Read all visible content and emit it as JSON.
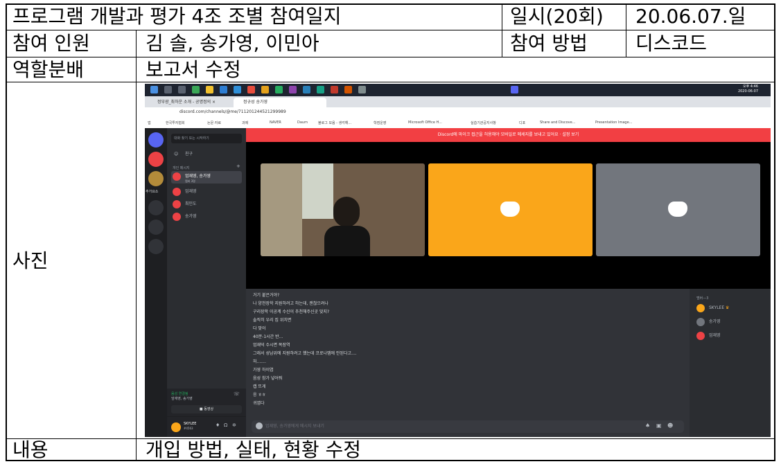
{
  "header": {
    "title": "프로그램 개발과 평가 4조 조별 참여일지",
    "date_label": "일시(20회)",
    "date_value": "20.06.07.일"
  },
  "participants": {
    "label": "참여 인원",
    "value": "김 솔, 송가영, 이민아",
    "method_label": "참여 방법",
    "method_value": "디스코드"
  },
  "role": {
    "label": "역할분배",
    "value": "보고서 수정"
  },
  "photo": {
    "label": "사진"
  },
  "content": {
    "label": "내용",
    "value": "개입 방법, 실태, 현황 수정"
  },
  "screenshot": {
    "clock": "오후 4:46",
    "clock_date": "2020-06-07",
    "tabs": [
      "정부광_최하운 소개 - 공명정의 ×",
      "정규성 송가영"
    ],
    "url": "discord.com/channels/@me/711201244521299989",
    "bookmarks": [
      "앱",
      "한국투자협회",
      "논문·자료",
      "과제",
      "NAVER",
      "Daum",
      "블로그 모음 - 생각해...",
      "학점운영",
      "Microsoft Office H...",
      "실습기관공지사항",
      "디포",
      "Share and Discove...",
      "Presentation Image..."
    ],
    "dm_search": "대화 찾기 또는 시작하기",
    "friends_label": "친구",
    "dm_header": "개인 메시지",
    "dm_items": [
      "엄재영, 송가영",
      "엄재영",
      "최민도",
      "송가영"
    ],
    "dm_sub": "멤버 3명",
    "server_label": "추가요소",
    "voice_status": "음성 연결됨",
    "voice_channel": "엄재영, 송가영",
    "video_button": "동영상",
    "user_name": "SKYLEE",
    "user_tag": "#4563",
    "banner": "Discord에 마이크 접근을 허용해야 모바일로 메세지를 보내고 있어요 · 설정 보기",
    "messages": [
      "거기 붙은거야?",
      "나 양천장학 지원하려고 하는데, 괜찮으려나",
      "구리장학 이공계 수신이 추천해주신곳 맞지?",
      "솔직히 우리 집 위치면",
      "다 맞어",
      "40분-1시간 반...",
      "엄재덕 수시면 복장역",
      "그래서 성남위에 지원하려고 했는데 코로나땜에 안된다고....",
      "허.......",
      "가영 하이염",
      "음성 참가 넣어줘",
      "캡 뜨게",
      "응 ㅎㅎ",
      "귀엽다"
    ],
    "members_header": "멤버—3",
    "members": [
      "SKYLEE",
      "송가영",
      "엄재영"
    ],
    "input_placeholder": "엄재영, 송가영에게 메시지 보내기",
    "colors": {
      "discord_red": "#f23f43",
      "discord_orange": "#faa61a",
      "discord_gray": "#72767d",
      "discord_bg": "#313338"
    }
  }
}
